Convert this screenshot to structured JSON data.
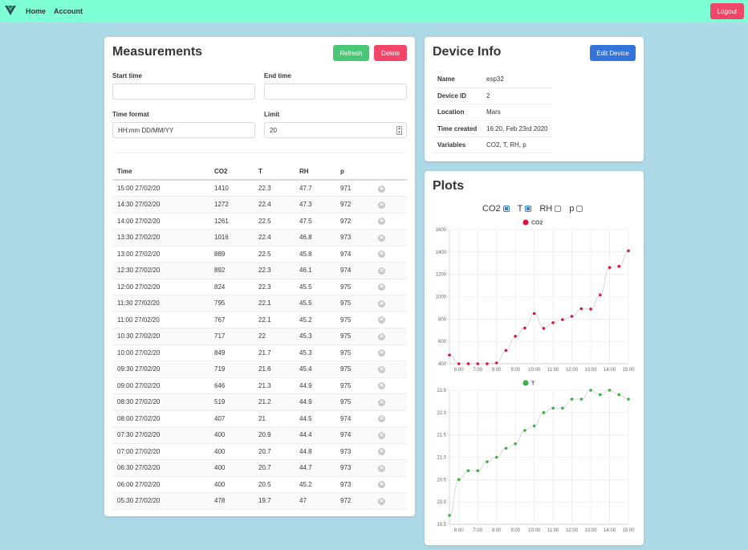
{
  "nav": {
    "home": "Home",
    "account": "Account",
    "logout": "Logout"
  },
  "colors": {
    "navbar": "#7fffd4",
    "background": "#add8e6",
    "refresh": "#48c774",
    "delete": "#f14668",
    "edit": "#3273dc",
    "co2": "#dc143c",
    "t": "#3cb043"
  },
  "measurements": {
    "title": "Measurements",
    "refresh_label": "Refresh",
    "delete_label": "Delete",
    "start_time_label": "Start time",
    "start_time_value": "",
    "end_time_label": "End time",
    "end_time_value": "",
    "time_format_label": "Time format",
    "time_format_value": "HH:mm DD/MM/YY",
    "limit_label": "Limit",
    "limit_value": "20",
    "headers": [
      "Time",
      "CO2",
      "T",
      "RH",
      "p"
    ],
    "rows": [
      [
        "15:00 27/02/20",
        "1410",
        "22.3",
        "47.7",
        "971"
      ],
      [
        "14:30 27/02/20",
        "1272",
        "22.4",
        "47.3",
        "972"
      ],
      [
        "14:00 27/02/20",
        "1261",
        "22.5",
        "47.5",
        "972"
      ],
      [
        "13:30 27/02/20",
        "1016",
        "22.4",
        "46.8",
        "973"
      ],
      [
        "13:00 27/02/20",
        "889",
        "22.5",
        "45.8",
        "974"
      ],
      [
        "12:30 27/02/20",
        "892",
        "22.3",
        "46.1",
        "974"
      ],
      [
        "12:00 27/02/20",
        "824",
        "22.3",
        "45.5",
        "975"
      ],
      [
        "11:30 27/02/20",
        "795",
        "22.1",
        "45.5",
        "975"
      ],
      [
        "11:00 27/02/20",
        "767",
        "22.1",
        "45.2",
        "975"
      ],
      [
        "10:30 27/02/20",
        "717",
        "22",
        "45.3",
        "975"
      ],
      [
        "10:00 27/02/20",
        "849",
        "21.7",
        "45.3",
        "975"
      ],
      [
        "09:30 27/02/20",
        "719",
        "21.6",
        "45.4",
        "975"
      ],
      [
        "09:00 27/02/20",
        "646",
        "21.3",
        "44.9",
        "975"
      ],
      [
        "08:30 27/02/20",
        "519",
        "21.2",
        "44.9",
        "975"
      ],
      [
        "08:00 27/02/20",
        "407",
        "21",
        "44.5",
        "974"
      ],
      [
        "07:30 27/02/20",
        "400",
        "20.9",
        "44.4",
        "974"
      ],
      [
        "07:00 27/02/20",
        "400",
        "20.7",
        "44.8",
        "973"
      ],
      [
        "06:30 27/02/20",
        "400",
        "20.7",
        "44.7",
        "973"
      ],
      [
        "06:00 27/02/20",
        "400",
        "20.5",
        "45.2",
        "973"
      ],
      [
        "05:30 27/02/20",
        "478",
        "19.7",
        "47",
        "972"
      ]
    ],
    "delete_icon": "x-circle-icon"
  },
  "device": {
    "title": "Device Info",
    "edit_label": "Edit Device",
    "rows": [
      {
        "key": "Name",
        "value": "esp32"
      },
      {
        "key": "Device ID",
        "value": "2"
      },
      {
        "key": "Location",
        "value": "Mars"
      },
      {
        "key": "Time created",
        "value": "16:20, Feb 23rd 2020"
      },
      {
        "key": "Variables",
        "value": "CO2, T, RH, p"
      }
    ]
  },
  "plots": {
    "title": "Plots",
    "toggles": [
      {
        "label": "CO2",
        "checked": true
      },
      {
        "label": "T",
        "checked": true
      },
      {
        "label": "RH",
        "checked": false
      },
      {
        "label": "p",
        "checked": false
      }
    ]
  },
  "chart_data": [
    {
      "type": "line",
      "series": [
        {
          "name": "CO2",
          "color": "#dc143c",
          "x": [
            "05:30",
            "06:00",
            "06:30",
            "07:00",
            "07:30",
            "08:00",
            "08:30",
            "09:00",
            "09:30",
            "10:00",
            "10:30",
            "11:00",
            "11:30",
            "12:00",
            "12:30",
            "13:00",
            "13:30",
            "14:00",
            "14:30",
            "15:00"
          ],
          "values": [
            478,
            400,
            400,
            400,
            400,
            407,
            519,
            646,
            719,
            849,
            717,
            767,
            795,
            824,
            892,
            889,
            1016,
            1261,
            1272,
            1410
          ]
        }
      ],
      "xticks": [
        "6:00",
        "7:00",
        "8:00",
        "9:00",
        "10:00",
        "11:00",
        "12:00",
        "13:00",
        "14:00",
        "15:00"
      ],
      "yticks": [
        400,
        600,
        800,
        1000,
        1200,
        1400,
        1600
      ],
      "ylim": [
        400,
        1600
      ],
      "xlim": [
        "05:30",
        "15:00"
      ],
      "grid": true,
      "legend": "top-center"
    },
    {
      "type": "line",
      "series": [
        {
          "name": "T",
          "color": "#3cb043",
          "x": [
            "05:30",
            "06:00",
            "06:30",
            "07:00",
            "07:30",
            "08:00",
            "08:30",
            "09:00",
            "09:30",
            "10:00",
            "10:30",
            "11:00",
            "11:30",
            "12:00",
            "12:30",
            "13:00",
            "13:30",
            "14:00",
            "14:30",
            "15:00"
          ],
          "values": [
            19.7,
            20.5,
            20.7,
            20.7,
            20.9,
            21,
            21.2,
            21.3,
            21.6,
            21.7,
            22,
            22.1,
            22.1,
            22.3,
            22.3,
            22.5,
            22.4,
            22.5,
            22.4,
            22.3
          ]
        }
      ],
      "xticks": [
        "6:00",
        "7:00",
        "8:00",
        "9:00",
        "10:00",
        "11:00",
        "12:00",
        "13:00",
        "14:00",
        "15:00"
      ],
      "yticks": [
        19.5,
        20.0,
        20.5,
        21.0,
        21.5,
        22.0,
        22.5
      ],
      "ylim": [
        19.5,
        22.5
      ],
      "xlim": [
        "05:30",
        "15:00"
      ],
      "grid": true,
      "legend": "top-center"
    }
  ]
}
